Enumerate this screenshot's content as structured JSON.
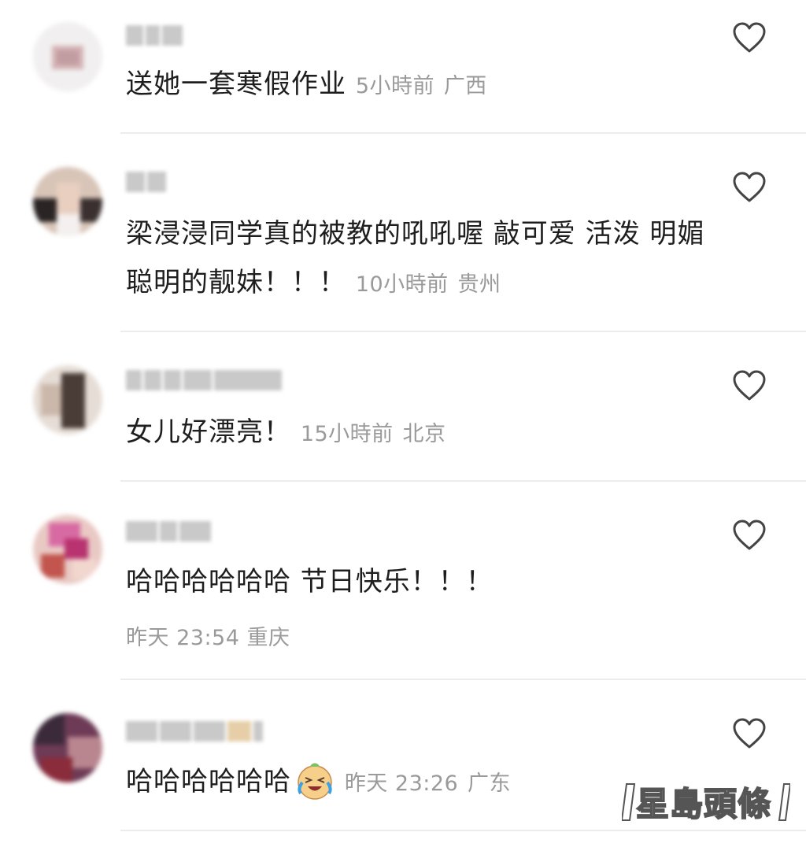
{
  "comments": [
    {
      "text": "送她一套寒假作业",
      "time": "5小時前",
      "location": "广西"
    },
    {
      "text": "梁浸浸同学真的被教的吼吼喔 敲可爱 活泼 明媚 聪明的靓妹！！！",
      "time": "10小時前",
      "location": "贵州"
    },
    {
      "text": "女儿好漂亮！",
      "time": "15小時前",
      "location": "北京"
    },
    {
      "text": "哈哈哈哈哈哈   节日快乐！！！",
      "time": "昨天 23:54",
      "location": "重庆"
    },
    {
      "text": "哈哈哈哈哈哈",
      "time": "昨天 23:26",
      "location": "广东"
    }
  ],
  "icons": {
    "like": "heart-outline-icon",
    "emoji": "laughing-crying-emoji"
  },
  "watermark": {
    "text": "星島頭條"
  },
  "colors": {
    "meta": "#9a9a9a",
    "divider": "#ececec",
    "heart": "#444444"
  }
}
